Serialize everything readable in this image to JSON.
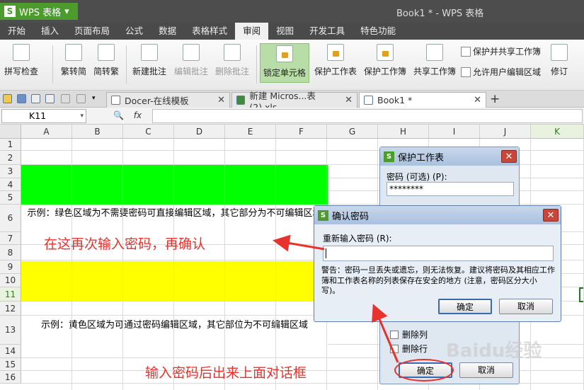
{
  "app": {
    "logo_glyph": "S",
    "name": "WPS 表格",
    "window_title": "Book1 * - WPS 表格"
  },
  "menu": [
    "开始",
    "插入",
    "页面布局",
    "公式",
    "数据",
    "表格样式",
    "审阅",
    "视图",
    "开发工具",
    "特色功能"
  ],
  "menu_active_index": 6,
  "ribbon": {
    "spell_check": "拼写检查",
    "trad_to_simp": "繁转简",
    "simp_to_trad": "简转繁",
    "new_comment": "新建批注",
    "edit_comment": "编辑批注",
    "delete_comment": "删除批注",
    "lock_cell": "锁定单元格",
    "protect_sheet": "保护工作表",
    "protect_workbook": "保护工作簿",
    "share_workbook": "共享工作簿",
    "protect_and_share": "保护并共享工作簿",
    "allow_edit_ranges": "允许用户编辑区域",
    "track_changes": "修订"
  },
  "tabs": [
    {
      "label": "Docer-在线模板"
    },
    {
      "label": "新建 Micros...表 (2).xls"
    },
    {
      "label": "Book1 *"
    }
  ],
  "formula_bar": {
    "cell_ref": "K11",
    "fx": "fx"
  },
  "columns": [
    "A",
    "B",
    "C",
    "D",
    "E",
    "F",
    "G",
    "H",
    "I",
    "J",
    "K"
  ],
  "rows": [
    "1",
    "2",
    "3",
    "4",
    "5",
    "6",
    "7",
    "8",
    "9",
    "10",
    "11",
    "12",
    "13",
    "14",
    "15",
    "16"
  ],
  "cells": {
    "note_green": "示例：绿色区域为不需要密码可直接编辑区域，其它部分为不可编辑区域",
    "note_yellow": "示例：黄色区域为可通过密码编辑区域，其它部位为不可编辑区域"
  },
  "annotations": {
    "top": "在这再次输入密码，再确认",
    "bottom": "输入密码后出来上面对话框"
  },
  "protect_dialog": {
    "title": "保护工作表",
    "password_label": "密码 (可选) (P):",
    "password_value": "********",
    "options": [
      "删除列",
      "删除行"
    ],
    "ok": "确定",
    "cancel": "取消"
  },
  "confirm_dialog": {
    "title": "确认密码",
    "reenter_label": "重新输入密码 (R):",
    "input_value": "",
    "warning": "警告：密码一旦丢失或遗忘，则无法恢复。建议将密码及其相应工作簿和工作表名称的列表保存在安全的地方 (注意，密码区分大小写)。",
    "ok": "确定",
    "cancel": "取消"
  },
  "watermark": "Baidu经验",
  "colors": {
    "green_fill": "#00ff00",
    "yellow_fill": "#ffff00",
    "annotation": "#e8322e",
    "wps_green": "#4b9b2d"
  }
}
